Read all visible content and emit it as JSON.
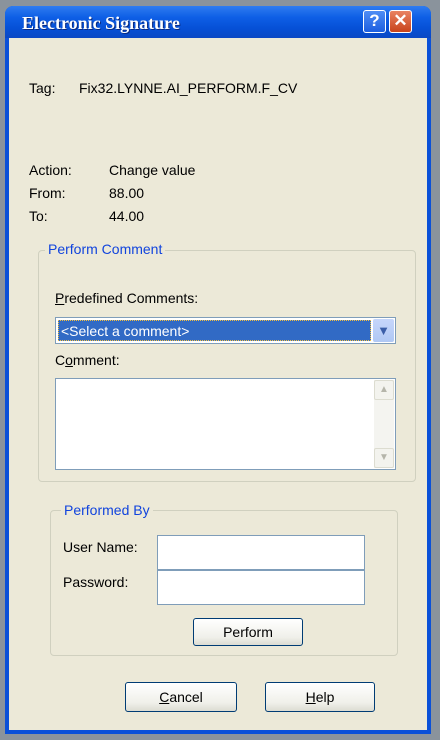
{
  "window": {
    "title": "Electronic Signature"
  },
  "tag": {
    "label": "Tag:",
    "value": "Fix32.LYNNE.AI_PERFORM.F_CV"
  },
  "action": {
    "label": "Action:",
    "value": "Change value"
  },
  "from": {
    "label": "From:",
    "value": "88.00"
  },
  "to": {
    "label": "To:",
    "value": "44.00"
  },
  "perform_comment": {
    "legend": "Perform Comment",
    "predefined_label_accel": "P",
    "predefined_label_rest": "redefined Comments:",
    "predefined_selected": "<Select a comment>",
    "comment_label_pre": "C",
    "comment_label_accel": "o",
    "comment_label_rest": "mment:",
    "comment_value": ""
  },
  "performed_by": {
    "legend": "Performed By",
    "username_label": "User Name:",
    "username_value": "",
    "password_label": "Password:",
    "password_value": "",
    "perform_button": "Perform"
  },
  "buttons": {
    "cancel_accel": "C",
    "cancel_rest": "ancel",
    "help_accel": "H",
    "help_rest": "elp"
  },
  "icons": {
    "help": "?",
    "close": "✕",
    "dropdown": "▼",
    "scroll_up": "▲",
    "scroll_down": "▼"
  }
}
